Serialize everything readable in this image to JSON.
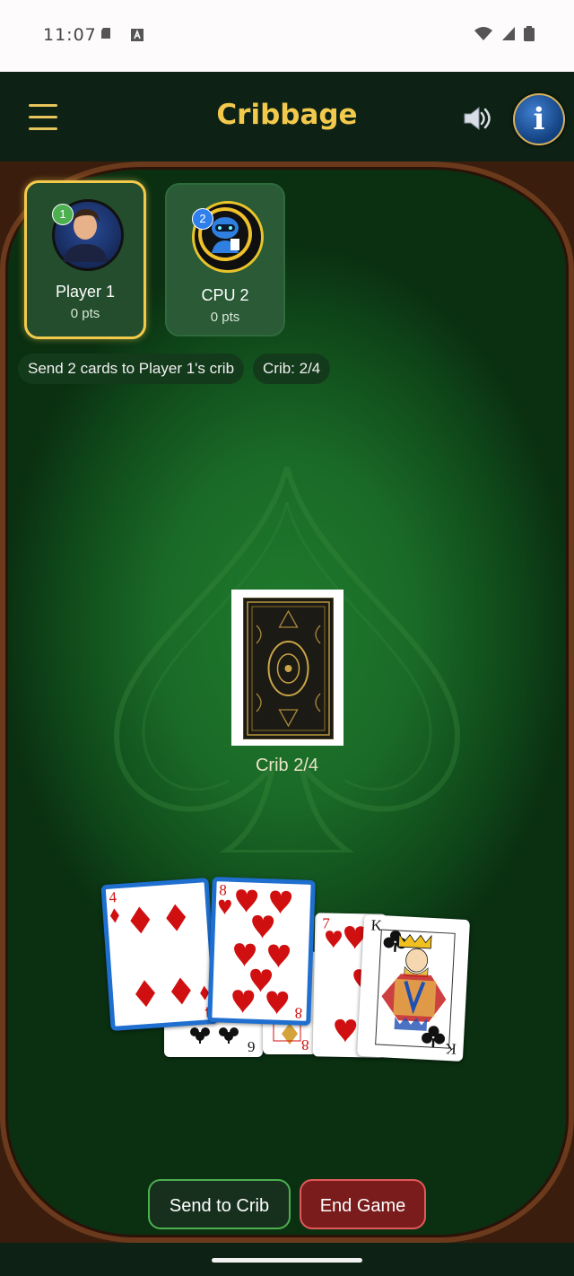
{
  "status_bar": {
    "time": "11:07"
  },
  "header": {
    "title": "Cribbage",
    "menu_icon": "hamburger-menu-icon",
    "sound_icon": "speaker-icon",
    "info_icon": "info-icon",
    "info_label": "i"
  },
  "players": [
    {
      "badge": "1",
      "name": "Player 1",
      "points": "0 pts",
      "active": true,
      "badge_color": "#4caf50"
    },
    {
      "badge": "2",
      "name": "CPU 2",
      "points": "0 pts",
      "active": false,
      "badge_color": "#2f80ed"
    }
  ],
  "status": {
    "instruction": "Send 2 cards to Player 1's crib",
    "crib_count": "Crib: 2/4"
  },
  "crib": {
    "label": "Crib 2/4"
  },
  "hand": [
    {
      "rank": "4",
      "suit": "diamonds",
      "selected": true
    },
    {
      "rank": "8",
      "suit": "hearts",
      "selected": true
    },
    {
      "rank": "7",
      "suit": "hearts",
      "selected": false
    },
    {
      "rank": "K",
      "suit": "clubs",
      "selected": false
    }
  ],
  "hidden_cards": [
    {
      "rank": "6",
      "suit": "clubs"
    },
    {
      "rank": "8",
      "suit": "diamonds"
    }
  ],
  "actions": {
    "send_to_crib": "Send to Crib",
    "end_game": "End Game"
  }
}
